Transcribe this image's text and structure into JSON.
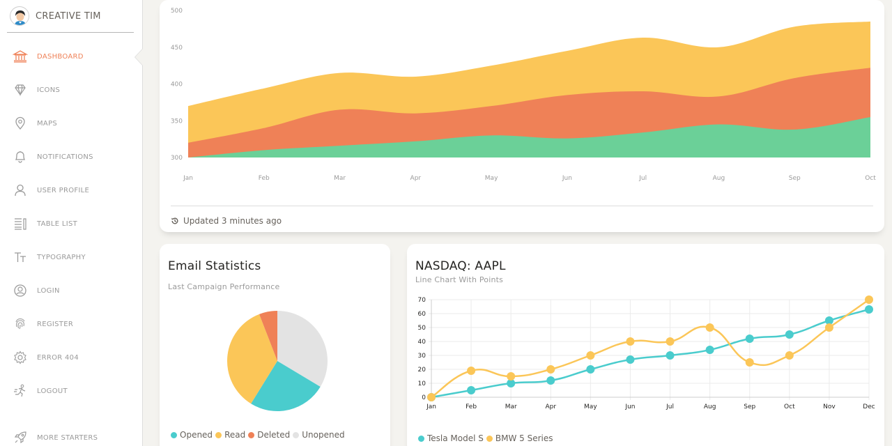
{
  "brand": {
    "name": "CREATIVE TIM"
  },
  "sidebar": {
    "items": [
      {
        "label": "DASHBOARD",
        "icon": "bank-icon",
        "active": true
      },
      {
        "label": "ICONS",
        "icon": "diamond-icon"
      },
      {
        "label": "MAPS",
        "icon": "map-pin-icon"
      },
      {
        "label": "NOTIFICATIONS",
        "icon": "bell-icon"
      },
      {
        "label": "USER PROFILE",
        "icon": "user-icon"
      },
      {
        "label": "TABLE LIST",
        "icon": "table-list-icon"
      },
      {
        "label": "TYPOGRAPHY",
        "icon": "typography-icon"
      },
      {
        "label": "LOGIN",
        "icon": "login-icon"
      },
      {
        "label": "REGISTER",
        "icon": "fingerprint-icon"
      },
      {
        "label": "ERROR 404",
        "icon": "settings-icon"
      },
      {
        "label": "LOGOUT",
        "icon": "logout-icon"
      },
      {
        "label": "MORE STARTERS",
        "icon": "rocket-icon"
      }
    ]
  },
  "colors": {
    "accent": "#ef8157",
    "green": "#6bd098",
    "yellow": "#fbc658",
    "teal": "#4acccd",
    "grey": "#e3e3e3"
  },
  "users_behavior": {
    "updated": "Updated 3 minutes ago",
    "chart_data": {
      "type": "area",
      "x": [
        "Jan",
        "Feb",
        "Mar",
        "Apr",
        "May",
        "Jun",
        "Jul",
        "Aug",
        "Sep",
        "Oct"
      ],
      "ylim": [
        300,
        500
      ],
      "yticks": [
        "500",
        "450",
        "400",
        "350",
        "300"
      ],
      "series": [
        {
          "color": "#6bd098",
          "values": [
            300,
            310,
            316,
            322,
            330,
            326,
            334,
            345,
            338,
            355
          ]
        },
        {
          "color": "#ef8157",
          "values": [
            320,
            340,
            365,
            360,
            370,
            385,
            390,
            383,
            408,
            422
          ]
        },
        {
          "color": "#fbc658",
          "values": [
            370,
            394,
            415,
            410,
            425,
            445,
            463,
            450,
            478,
            485
          ]
        }
      ]
    }
  },
  "email_stats": {
    "title": "Email Statistics",
    "subtitle": "Last Campaign Performance",
    "chart_data": {
      "type": "pie",
      "labels": [
        "Opened",
        "Read",
        "Deleted",
        "Unopened"
      ],
      "values": [
        343,
        480,
        80,
        457
      ],
      "colors": [
        "#4acccd",
        "#fbc658",
        "#ef8157",
        "#e3e3e3"
      ],
      "order": [
        "Unopened",
        "Opened",
        "Read",
        "Deleted"
      ]
    }
  },
  "nasdaq": {
    "title": "NASDAQ: AAPL",
    "subtitle": "Line Chart With Points",
    "chart_data": {
      "type": "line",
      "x": [
        "Jan",
        "Feb",
        "Mar",
        "Apr",
        "May",
        "Jun",
        "Jul",
        "Aug",
        "Sep",
        "Oct",
        "Nov",
        "Dec"
      ],
      "ylim": [
        0,
        70
      ],
      "yticks": [
        "70",
        "60",
        "50",
        "40",
        "30",
        "20",
        "10",
        "0"
      ],
      "series": [
        {
          "name": "Tesla Model S",
          "color": "#4acccd",
          "values": [
            0,
            5,
            10,
            12,
            20,
            27,
            30,
            34,
            42,
            45,
            55,
            63
          ]
        },
        {
          "name": "BMW 5 Series",
          "color": "#fbc658",
          "values": [
            0,
            19,
            15,
            20,
            30,
            40,
            40,
            50,
            25,
            30,
            50,
            70
          ]
        }
      ]
    }
  }
}
